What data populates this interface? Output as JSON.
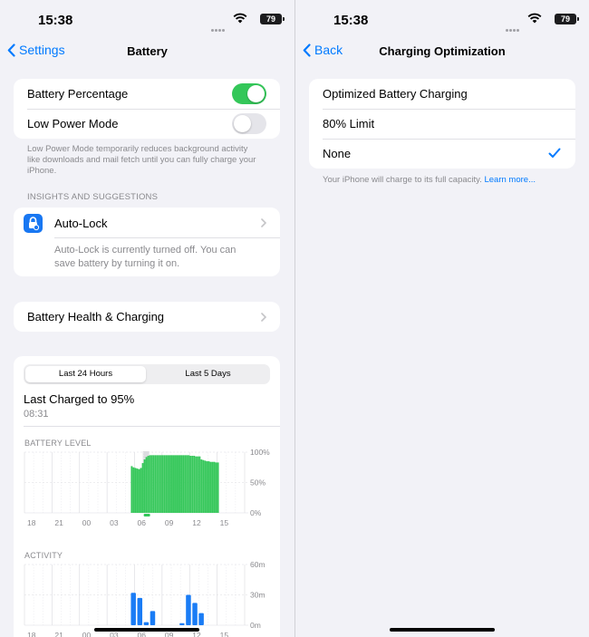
{
  "status": {
    "time": "15:38",
    "battery": "79"
  },
  "left": {
    "nav": {
      "back": "Settings",
      "title": "Battery"
    },
    "toggles": [
      {
        "label": "Battery Percentage",
        "on": true
      },
      {
        "label": "Low Power Mode",
        "on": false
      }
    ],
    "low_power_note": "Low Power Mode temporarily reduces background activity like downloads and mail fetch until you can fully charge your iPhone.",
    "insights_header": "INSIGHTS AND SUGGESTIONS",
    "autolock": {
      "label": "Auto-Lock",
      "note": "Auto-Lock is currently turned off. You can save battery by turning it on."
    },
    "health_label": "Battery Health & Charging",
    "segments": {
      "selected": "Last 24 Hours",
      "other": "Last 5 Days"
    },
    "last_charged": {
      "title": "Last Charged to 95%",
      "time": "08:31"
    },
    "battery_chart": {
      "label": "BATTERY LEVEL",
      "y_ticks": [
        "100%",
        "50%",
        "0%"
      ],
      "x_ticks": [
        "18",
        "21",
        "00",
        "03",
        "06",
        "09",
        "12",
        "15"
      ]
    },
    "activity_chart": {
      "label": "ACTIVITY",
      "y_ticks": [
        "60m",
        "30m",
        "0m"
      ],
      "x_ticks": [
        "18",
        "21",
        "00",
        "03",
        "06",
        "09",
        "12",
        "15"
      ]
    }
  },
  "right": {
    "nav": {
      "back": "Back",
      "title": "Charging Optimization"
    },
    "options": [
      {
        "label": "Optimized Battery Charging",
        "checked": false
      },
      {
        "label": "80% Limit",
        "checked": false
      },
      {
        "label": "None",
        "checked": true
      }
    ],
    "note": "Your iPhone will charge to its full capacity.",
    "learn_more": "Learn more..."
  },
  "chart_data": [
    {
      "type": "bar",
      "title": "BATTERY LEVEL",
      "x_ticks": [
        "18",
        "21",
        "00",
        "03",
        "06",
        "09",
        "12",
        "15"
      ],
      "ylim": [
        0,
        100
      ],
      "y_ticks": [
        "100%",
        "50%",
        "0%"
      ],
      "series": [
        {
          "values": [
            {
              "h": 5.6,
              "y": 77
            },
            {
              "h": 5.8,
              "y": 75
            },
            {
              "h": 6.0,
              "y": 74
            },
            {
              "h": 6.2,
              "y": 73
            },
            {
              "h": 6.4,
              "y": 72
            },
            {
              "h": 6.6,
              "y": 74
            },
            {
              "h": 6.8,
              "y": 82
            },
            {
              "h": 7.0,
              "y": 88
            },
            {
              "h": 7.2,
              "y": 92
            },
            {
              "h": 7.4,
              "y": 94
            },
            {
              "h": 7.6,
              "y": 95
            },
            {
              "h": 7.8,
              "y": 95
            },
            {
              "h": 8.0,
              "y": 95
            },
            {
              "h": 8.2,
              "y": 95
            },
            {
              "h": 8.4,
              "y": 95
            },
            {
              "h": 8.6,
              "y": 95
            },
            {
              "h": 8.8,
              "y": 95
            },
            {
              "h": 9.0,
              "y": 95
            },
            {
              "h": 9.2,
              "y": 95
            },
            {
              "h": 9.4,
              "y": 95
            },
            {
              "h": 9.6,
              "y": 95
            },
            {
              "h": 9.8,
              "y": 95
            },
            {
              "h": 10.0,
              "y": 95
            },
            {
              "h": 10.2,
              "y": 95
            },
            {
              "h": 10.4,
              "y": 95
            },
            {
              "h": 10.6,
              "y": 95
            },
            {
              "h": 10.8,
              "y": 95
            },
            {
              "h": 11.0,
              "y": 95
            },
            {
              "h": 11.2,
              "y": 95
            },
            {
              "h": 11.4,
              "y": 95
            },
            {
              "h": 11.6,
              "y": 95
            },
            {
              "h": 11.8,
              "y": 95
            },
            {
              "h": 12.0,
              "y": 94
            },
            {
              "h": 12.2,
              "y": 94
            },
            {
              "h": 12.4,
              "y": 94
            },
            {
              "h": 12.6,
              "y": 93
            },
            {
              "h": 12.8,
              "y": 93
            },
            {
              "h": 13.0,
              "y": 93
            },
            {
              "h": 13.2,
              "y": 88
            },
            {
              "h": 13.4,
              "y": 87
            },
            {
              "h": 13.6,
              "y": 86
            },
            {
              "h": 13.8,
              "y": 85
            },
            {
              "h": 14.0,
              "y": 85
            },
            {
              "h": 14.2,
              "y": 84
            },
            {
              "h": 14.4,
              "y": 84
            },
            {
              "h": 14.6,
              "y": 84
            },
            {
              "h": 14.8,
              "y": 83
            },
            {
              "h": 15.0,
              "y": 83
            }
          ]
        }
      ]
    },
    {
      "type": "bar",
      "title": "ACTIVITY",
      "x_ticks": [
        "18",
        "21",
        "00",
        "03",
        "06",
        "09",
        "12",
        "15"
      ],
      "ylim": [
        0,
        60
      ],
      "y_ticks": [
        "60m",
        "30m",
        "0m"
      ],
      "series": [
        {
          "values": [
            {
              "h": 5.6,
              "y": 32
            },
            {
              "h": 6.3,
              "y": 27
            },
            {
              "h": 7.0,
              "y": 3
            },
            {
              "h": 7.7,
              "y": 14
            },
            {
              "h": 10.9,
              "y": 2
            },
            {
              "h": 11.6,
              "y": 30
            },
            {
              "h": 12.3,
              "y": 22
            },
            {
              "h": 13.0,
              "y": 12
            }
          ]
        }
      ]
    }
  ]
}
